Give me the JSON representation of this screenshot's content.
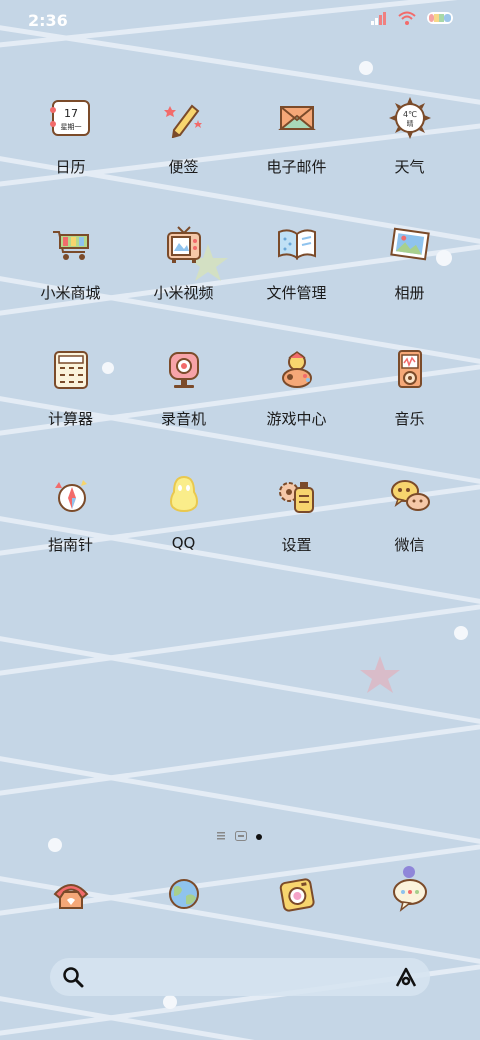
{
  "status_bar": {
    "time": "2:36",
    "icons": [
      "signal-icon",
      "wifi-icon",
      "battery-icon"
    ]
  },
  "apps": [
    [
      {
        "label": "日历",
        "icon": "calendar-icon",
        "calendar_day": "17",
        "calendar_weekday": "星期一"
      },
      {
        "label": "便签",
        "icon": "notes-pencil-icon"
      },
      {
        "label": "电子邮件",
        "icon": "email-envelope-icon"
      },
      {
        "label": "天气",
        "icon": "weather-sun-icon",
        "temperature": "4℃",
        "condition": "晴"
      }
    ],
    [
      {
        "label": "小米商城",
        "icon": "shopping-cart-icon"
      },
      {
        "label": "小米视频",
        "icon": "tv-video-icon"
      },
      {
        "label": "文件管理",
        "icon": "file-book-icon"
      },
      {
        "label": "相册",
        "icon": "photo-album-icon"
      }
    ],
    [
      {
        "label": "计算器",
        "icon": "calculator-icon"
      },
      {
        "label": "录音机",
        "icon": "recorder-icon"
      },
      {
        "label": "游戏中心",
        "icon": "game-center-icon"
      },
      {
        "label": "音乐",
        "icon": "music-player-icon"
      }
    ],
    [
      {
        "label": "指南针",
        "icon": "compass-icon"
      },
      {
        "label": "QQ",
        "icon": "qq-penguin-icon"
      },
      {
        "label": "设置",
        "icon": "settings-gear-icon"
      },
      {
        "label": "微信",
        "icon": "wechat-bubbles-icon"
      }
    ]
  ],
  "dock": [
    {
      "icon": "phone-icon"
    },
    {
      "icon": "browser-globe-icon"
    },
    {
      "icon": "camera-icon"
    },
    {
      "icon": "messages-icon"
    }
  ],
  "search": {
    "icon": "search-icon",
    "assistant_icon": "assistant-icon"
  },
  "colors": {
    "background": "#c5d6e6",
    "stripes": "#e6eef6",
    "label": "#1b1b1b"
  }
}
